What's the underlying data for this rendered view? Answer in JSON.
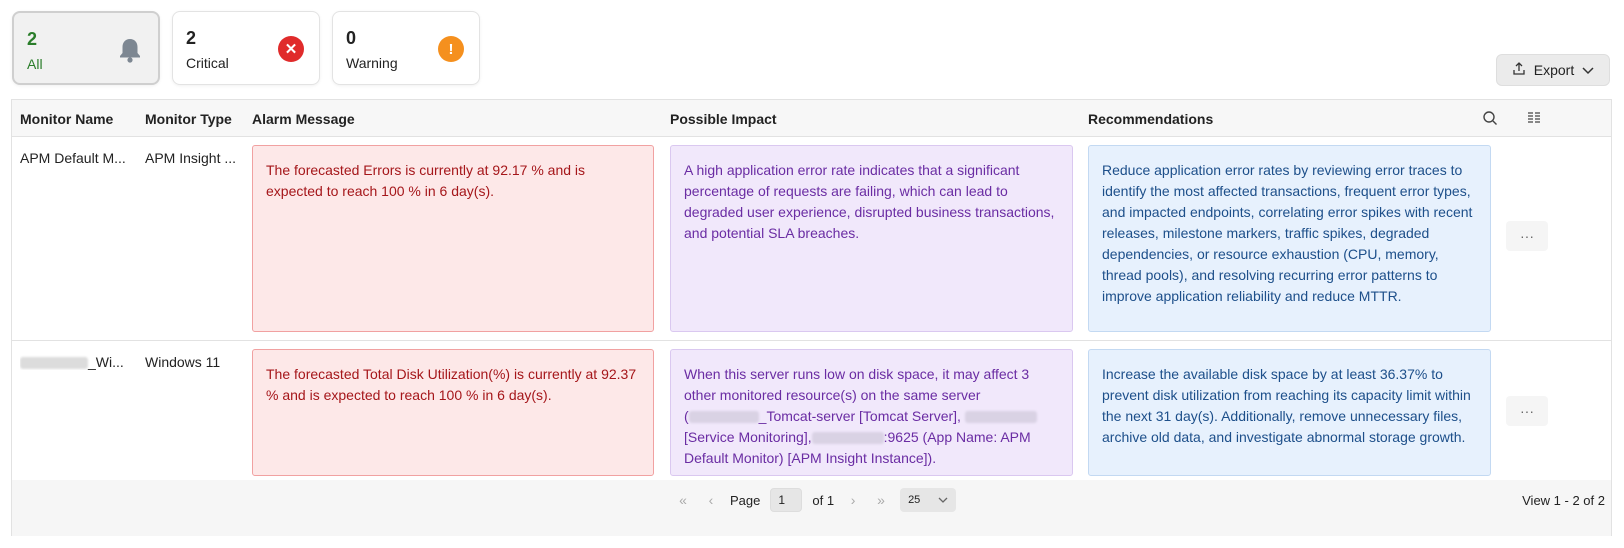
{
  "summary": [
    {
      "count": "2",
      "label": "All",
      "icon": "bell-icon"
    },
    {
      "count": "2",
      "label": "Critical",
      "icon": "close-circle-icon"
    },
    {
      "count": "0",
      "label": "Warning",
      "icon": "exclamation-circle-icon"
    }
  ],
  "toolbar": {
    "export_label": "Export"
  },
  "columns": {
    "monitor_name": "Monitor Name",
    "monitor_type": "Monitor Type",
    "alarm_message": "Alarm Message",
    "possible_impact": "Possible Impact",
    "recommendations": "Recommendations"
  },
  "rows": [
    {
      "monitor_name": "APM Default M...",
      "monitor_type": "APM Insight ...",
      "alarm": "The forecasted Errors is currently at 92.17 % and is expected to reach 100 % in 6 day(s).",
      "impact": "A high application error rate indicates that a significant percentage of requests are failing, which can lead to degraded user experience, disrupted business transactions, and potential SLA breaches.",
      "recommendation": "Reduce application error rates by reviewing error traces to identify the most affected transactions, frequent error types, and impacted endpoints, correlating error spikes with recent releases, milestone markers, traffic spikes, degraded dependencies, or resource exhaustion (CPU, memory, thread pools), and resolving recurring error patterns to improve application reliability and reduce MTTR."
    },
    {
      "monitor_name": "_Wi...",
      "monitor_type": "Windows 11",
      "alarm": "The forecasted Total Disk Utilization(%) is currently at 92.37 % and is expected to reach 100 % in 6 day(s).",
      "impact_l1": "When this server runs low on disk space, it may affect 3",
      "impact_l2": "other monitored resource(s) on the same server",
      "impact_l3a": "(",
      "impact_l3b": "_Tomcat-server [Tomcat Server],",
      "impact_l4a": "[Service Monitoring],",
      "impact_l4b": ":9625 (App Name: APM",
      "impact_l5": "Default Monitor) [APM Insight Instance]).",
      "recommendation": "Increase the available disk space by at least 36.37% to prevent disk utilization from reaching its capacity limit within the next 31 day(s). Additionally, remove unnecessary files, archive old data, and investigate abnormal storage growth."
    }
  ],
  "row_action_label": "···",
  "pagination": {
    "page_label": "Page",
    "current_page": "1",
    "of_label": "of 1",
    "page_size": "25",
    "view_info": "View 1 - 2 of 2"
  }
}
